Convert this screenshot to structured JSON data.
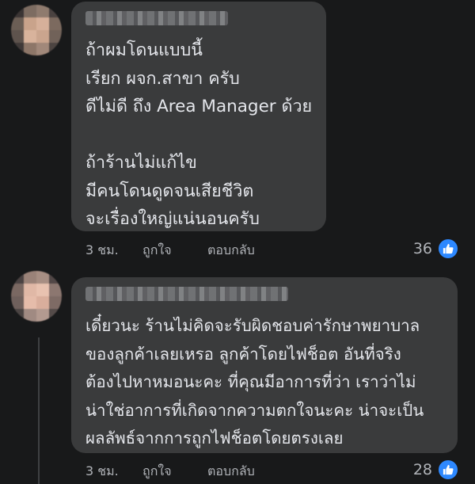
{
  "comments": [
    {
      "body": "ถ้าผมโดนแบบนี้\nเรียก ผจก.สาขา ครับ\nดีไม่ดี ถึง Area Manager ด้วย\n\nถ้าร้านไม่แก้ไข\nมีคนโดนดูดจนเสียชีวิต\nจะเรื่องใหญ่แน่นอนครับ",
      "time": "3 ชม.",
      "like": "ถูกใจ",
      "reply": "ตอบกลับ",
      "reaction_count": "36"
    },
    {
      "body": "เดี๋ยวนะ ร้านไม่คิดจะรับผิดชอบค่ารักษาพยาบาล\nของลูกค้าเลยเหรอ ลูกค้าโดยไฟช็อต อันที่จริง\nต้องไปหาหมอนะคะ ที่คุณมีอาการที่ว่า เราว่าไม่\nน่าใช่อาการที่เกิดจากความตกใจนะคะ น่าจะเป็น\nผลลัพธ์จากการถูกไฟช็อตโดยตรงเลย",
      "time": "3 ชม.",
      "like": "ถูกใจ",
      "reply": "ตอบกลับ",
      "reaction_count": "28"
    }
  ],
  "colors": {
    "background": "#18191a",
    "bubble": "#3a3b3c",
    "text": "#e4e6eb",
    "meta": "#b0b3b8",
    "like_badge": "#2d88ff"
  }
}
